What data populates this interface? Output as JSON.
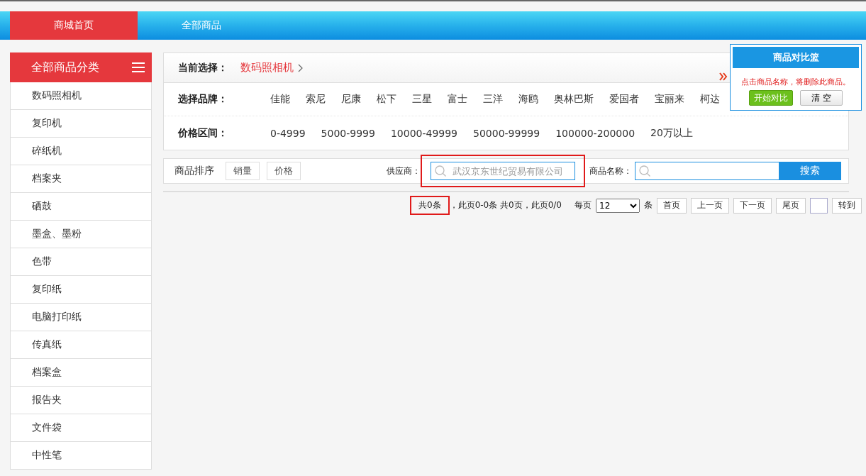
{
  "nav": {
    "tabs": [
      {
        "label": "商城首页",
        "selected": true
      },
      {
        "label": "全部商品",
        "selected": false
      }
    ]
  },
  "sidebar": {
    "title": "全部商品分类",
    "items": [
      "数码照相机",
      "复印机",
      "碎纸机",
      "档案夹",
      "硒鼓",
      "墨盒、墨粉",
      "色带",
      "复印纸",
      "电脑打印纸",
      "传真纸",
      "档案盒",
      "报告夹",
      "文件袋",
      "中性笔"
    ]
  },
  "filters": {
    "current_label": "当前选择：",
    "current_value": "数码照相机",
    "brand_label": "选择品牌：",
    "brands": [
      "佳能",
      "索尼",
      "尼康",
      "松下",
      "三星",
      "富士",
      "三洋",
      "海鸥",
      "奥林巴斯",
      "爱国者",
      "宝丽来",
      "柯达"
    ],
    "price_label": "价格区间：",
    "prices": [
      "0-4999",
      "5000-9999",
      "10000-49999",
      "50000-99999",
      "100000-200000",
      "20万以上"
    ]
  },
  "sort_bar": {
    "label": "商品排序",
    "buttons": [
      "销量",
      "价格"
    ],
    "supplier_label": "供应商：",
    "supplier_placeholder": "武汉京东世纪贸易有限公司",
    "name_label": "商品名称：",
    "search_button": "搜索"
  },
  "pagination": {
    "total": "共0条",
    "summary": "，此页0-0条 共0页，此页0/0",
    "per_page_label": "每页",
    "per_page": "12",
    "per_page_unit": "条",
    "buttons": [
      "首页",
      "上一页",
      "下一页",
      "尾页"
    ],
    "go_button": "转到"
  },
  "compare_basket": {
    "title": "商品对比篮",
    "hint": "点击商品名称，将删除此商品。",
    "start_button": "开始对比",
    "clear_button": "清 空"
  }
}
